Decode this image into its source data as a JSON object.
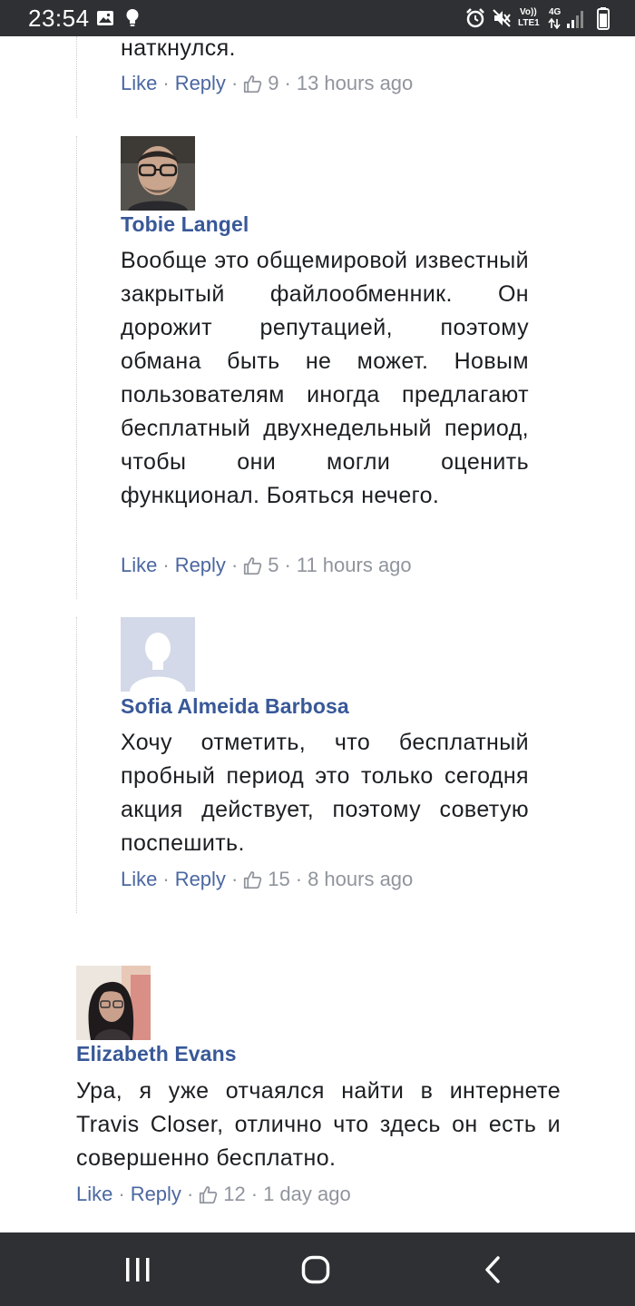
{
  "status_bar": {
    "time": "23:54",
    "net_volte": "Vo))",
    "net_lte": "LTE1",
    "net_4g": "4G",
    "icons": [
      "image-icon",
      "lightbulb-icon",
      "alarm-icon",
      "mute-icon",
      "signal-icon"
    ]
  },
  "comments": [
    {
      "body": "наткнулся.",
      "actions": {
        "like": "Like",
        "reply": "Reply",
        "likes": "9",
        "time": "13 hours ago"
      }
    },
    {
      "author": "Tobie Langel",
      "body": "Вообще это общемировой известный закрытый файлообменник. Он дорожит репутацией, поэтому обмана быть не может. Новым пользователям иногда предлагают бесплатный двухнедельный период, чтобы они могли оценить функционал. Бояться нечего.",
      "actions": {
        "like": "Like",
        "reply": "Reply",
        "likes": "5",
        "time": "11 hours ago"
      }
    },
    {
      "author": "Sofia Almeida Barbosa",
      "body": "Хочу отметить, что бесплатный пробный период это только сегодня акция действует, поэтому советую поспешить.",
      "actions": {
        "like": "Like",
        "reply": "Reply",
        "likes": "15",
        "time": "8 hours ago"
      }
    },
    {
      "author": "Elizabeth Evans",
      "body": "Ура, я уже отчаялся найти в интернете Travis Closer, отлично что здесь он есть и совершенно бесплатно.",
      "actions": {
        "like": "Like",
        "reply": "Reply",
        "likes": "12",
        "time": "1 day ago"
      }
    }
  ],
  "colors": {
    "author": "#385898",
    "link": "#4b67a1",
    "meta": "#90949c",
    "text": "#1c1e21",
    "system_bar": "#2f3033"
  }
}
